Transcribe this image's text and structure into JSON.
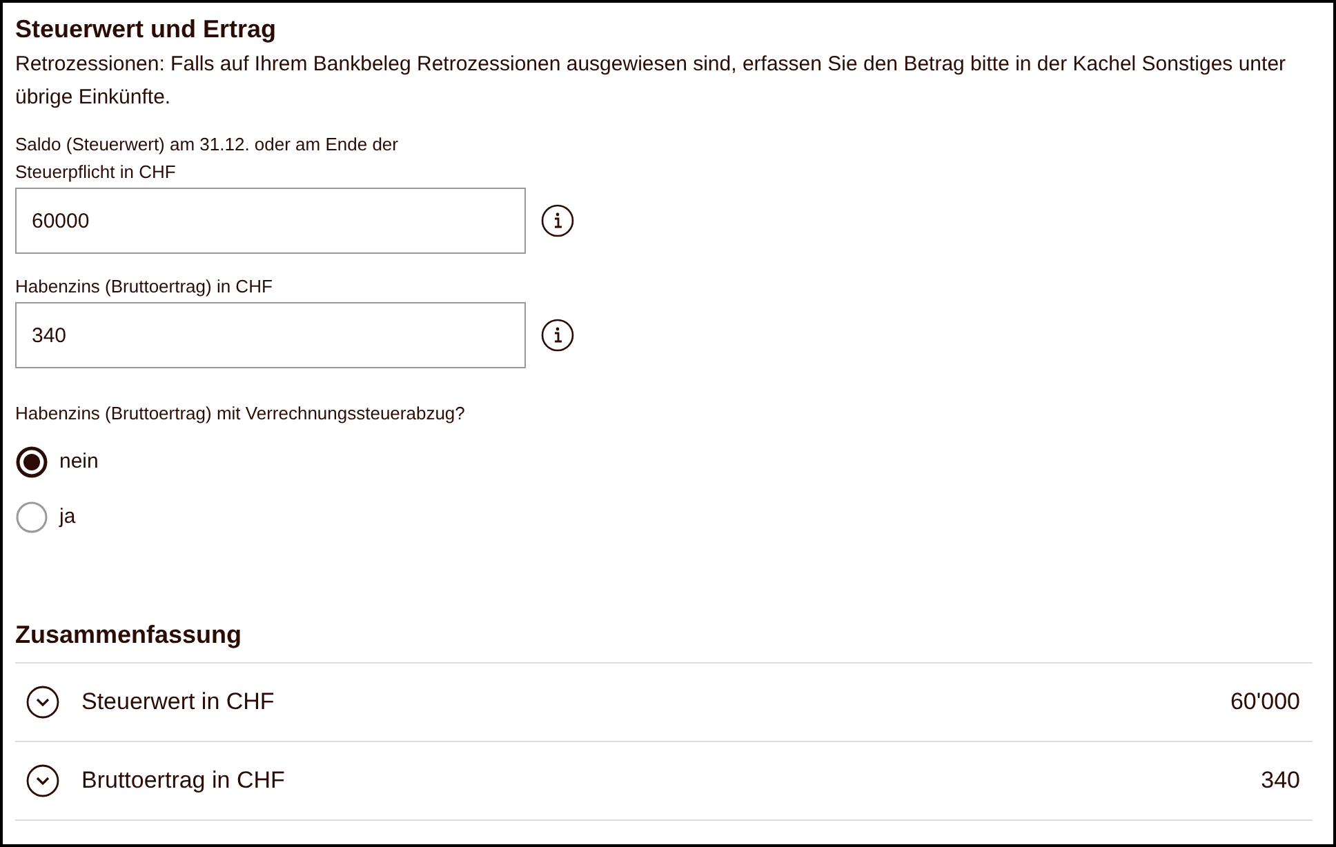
{
  "section": {
    "title": "Steuerwert und Ertrag",
    "note": "Retrozessionen: Falls auf Ihrem Bankbeleg Retrozessionen ausgewiesen sind, erfassen Sie den Betrag bitte in der Kachel Sonstiges unter übrige Einkünfte."
  },
  "fields": [
    {
      "label": "Saldo (Steuerwert) am 31.12. oder am Ende der Steuerpflicht in CHF",
      "value": "60000"
    },
    {
      "label": "Habenzins (Bruttoertrag) in CHF",
      "value": "340"
    }
  ],
  "question": {
    "label": "Habenzins (Bruttoertrag) mit Verrechnungssteuerabzug?",
    "options": [
      {
        "label": "nein",
        "selected": true
      },
      {
        "label": "ja",
        "selected": false
      }
    ]
  },
  "summary": {
    "title": "Zusammenfassung",
    "rows": [
      {
        "label": "Steuerwert in CHF",
        "value": "60'000",
        "expanded": false
      },
      {
        "label": "Bruttoertrag in CHF",
        "value": "340",
        "expanded": false
      }
    ]
  }
}
